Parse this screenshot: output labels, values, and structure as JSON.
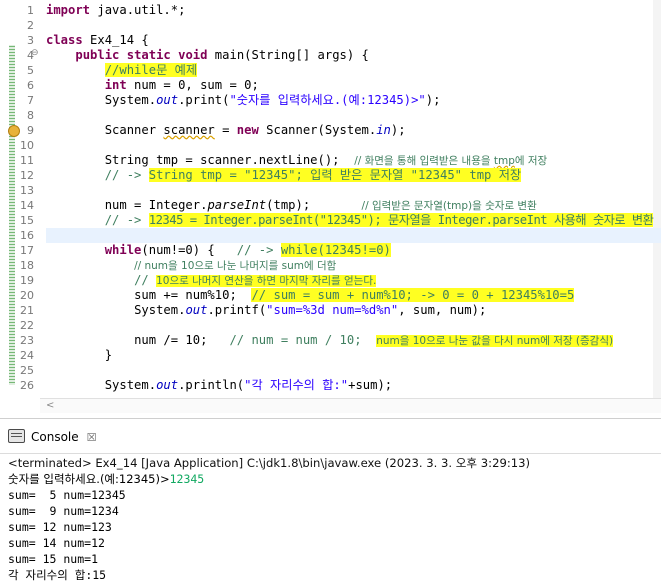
{
  "editor": {
    "line_numbers": [
      "1",
      "2",
      "3",
      "4",
      "5",
      "6",
      "7",
      "8",
      "9",
      "10",
      "11",
      "12",
      "13",
      "14",
      "15",
      "16",
      "17",
      "18",
      "19",
      "20",
      "21",
      "22",
      "23",
      "24",
      "25",
      "26"
    ],
    "fold_marker": "⊖",
    "code": {
      "l1_kw": "import",
      "l1_rest": " java.util.*;",
      "l3_kw": "class",
      "l3_rest": " Ex4_14 {",
      "l4_kw1": "public",
      "l4_kw2": "static",
      "l4_kw3": "void",
      "l4_rest": " main(String[] args) {",
      "l5_cm": "//while문 예제",
      "l6_kw": "int",
      "l6_rest": " num = 0, sum = 0;",
      "l7_a": "System.",
      "l7_out": "out",
      "l7_b": ".print(",
      "l7_str": "\"숫자를 입력하세요.(예:12345)>\"",
      "l7_c": ");",
      "l9_a": "Scanner ",
      "l9_var": "scanner",
      "l9_b": " = ",
      "l9_kw": "new",
      "l9_c": " Scanner(System.",
      "l9_in": "in",
      "l9_d": ");",
      "l11_a": "String tmp = scanner.nextLine();  ",
      "l11_cm1": "// 화면을 통해 입력받은 내용을 ",
      "l11_cmv": "tmp",
      "l11_cm2": "에 저장",
      "l12_cm1": "// -> ",
      "l12_cm2": "String tmp = \"12345\"; 입력 받은 문자열 \"12345\" tmp 저장",
      "l14_a": "num = Integer.",
      "l14_pi": "parseInt",
      "l14_b": "(tmp);",
      "l14_gap": "       ",
      "l14_cm": "// 입력받은 문자열(tmp)을 숫자로 변환",
      "l15_cm1": "// -> ",
      "l15_cm2": "12345 = Integer.parseInt(\"12345\"); 문자열을 Integer.parseInt 사용해 숫자로 변환",
      "l17_kw": "while",
      "l17_a": "(num!=0) {   ",
      "l17_cm1": "// -> ",
      "l17_cm2": "while(12345!=0)",
      "l18_cm": "// num을 10으로 나눈 나머지를 sum에 더함",
      "l19_cm1": "// ",
      "l19_cm2": "10으로 나머지 연산을 하면 마지막 자리를 얻는다.",
      "l20_a": "sum += num%10;  ",
      "l20_cm": "// sum = sum + num%10; -> 0 = 0 + 12345%10=5",
      "l21_a": "System.",
      "l21_out": "out",
      "l21_b": ".printf(",
      "l21_str": "\"sum=%3d num=%d%n\"",
      "l21_c": ", sum, num);",
      "l23_a": "num /= 10;   ",
      "l23_cm": "// num = num / 10;  ",
      "l23_hl": "num을 10으로 나눈 값을 다시 num에 저장 (증감식)",
      "l24": "}",
      "l26_a": "System.",
      "l26_out": "out",
      "l26_b": ".println(",
      "l26_str": "\"각 자리수의 합:\"",
      "l26_c": "+sum);"
    }
  },
  "console": {
    "tab_label": "Console",
    "close_glyph": "☒",
    "terminated": "<terminated> Ex4_14 [Java Application] C:\\jdk1.8\\bin\\javaw.exe (2023. 3. 3. 오후 3:29:13)",
    "prompt": "숫자를 입력하세요.(예:12345)>",
    "user_input": "12345",
    "output_lines": [
      "sum=  5 num=12345",
      "sum=  9 num=1234",
      "sum= 12 num=123",
      "sum= 14 num=12",
      "sum= 15 num=1",
      "각 자리수의 합:15"
    ]
  },
  "colors": {
    "keyword": "#7f0055",
    "comment": "#3f7f5f",
    "string": "#2a00ff",
    "field": "#0000c0",
    "highlight": "#ffff22",
    "current_line": "#e8f2fe",
    "input": "#10a860"
  }
}
